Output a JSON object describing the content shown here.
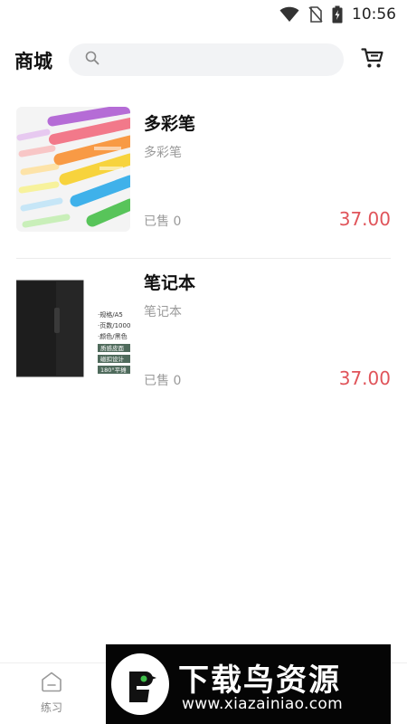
{
  "status_bar": {
    "time": "10:56",
    "icons": [
      "wifi-icon",
      "no-sim-icon",
      "battery-charging-icon"
    ]
  },
  "header": {
    "title": "商城",
    "search": {
      "value": "",
      "placeholder": ""
    },
    "cart_icon": "cart-icon"
  },
  "products": [
    {
      "name": "多彩笔",
      "description": "多彩笔",
      "sold": "已售 0",
      "price": "37.00"
    },
    {
      "name": "笔记本",
      "description": "笔记本",
      "sold": "已售 0",
      "price": "37.00"
    }
  ],
  "notebook_image_text": [
    "·规格/A5",
    "·页数/1000",
    "·颜色/黑色",
    "质感皮面",
    "磁扣设计",
    "180°平摊"
  ],
  "tab_bar": {
    "items": [
      {
        "label": "练习",
        "icon": "home-icon"
      }
    ]
  },
  "watermark": {
    "title": "下载鸟资源",
    "url": "www.xiazainiao.com"
  },
  "colors": {
    "price": "#e0545a",
    "search_bg": "#f2f3f5",
    "muted_text": "#9a9a9a"
  }
}
